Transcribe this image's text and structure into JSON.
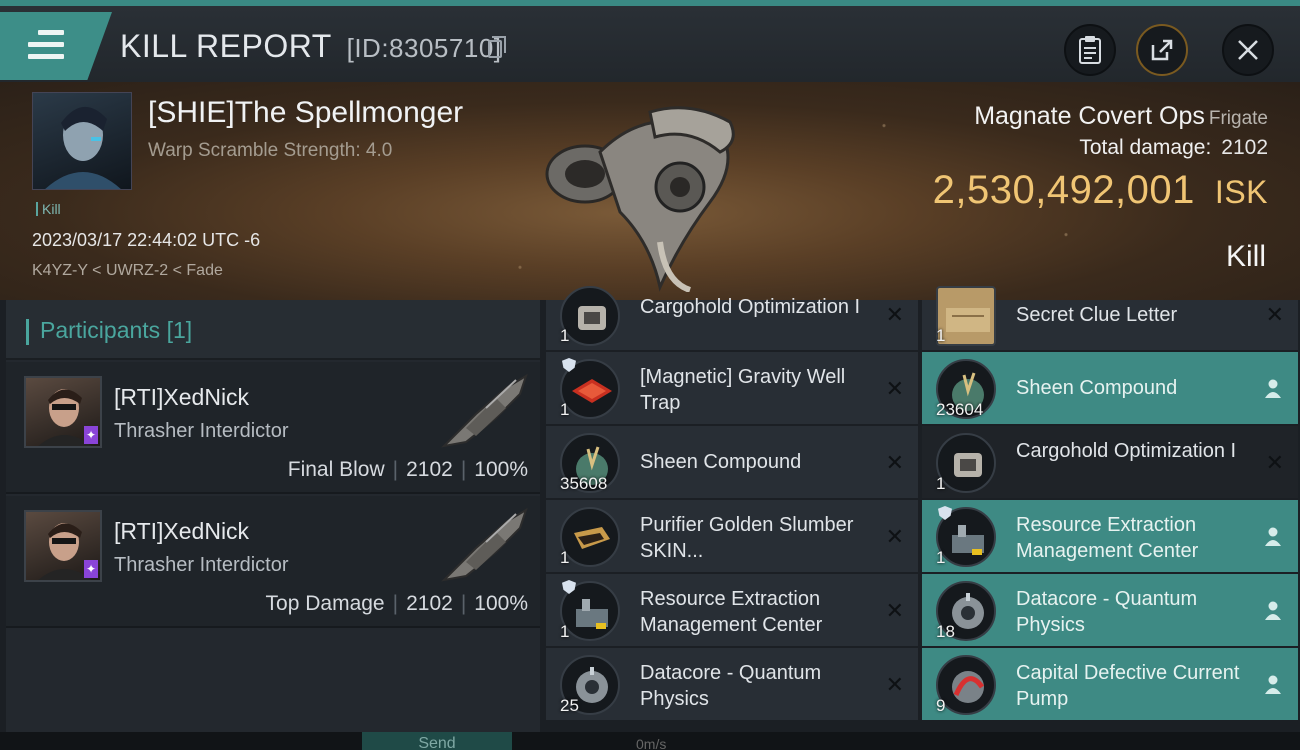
{
  "header": {
    "title": "KILL REPORT",
    "id_text": "[ID:8305710]",
    "icons": [
      "menu-icon",
      "copy-icon",
      "clipboard-icon",
      "share-icon",
      "close-icon"
    ]
  },
  "victim": {
    "name": "[SHIE]The Spellmonger",
    "warp_scramble": "Warp Scramble Strength: 4.0",
    "tag": "Kill",
    "timestamp": "2023/03/17 22:44:02 UTC -6",
    "route": "K4YZ-Y < UWRZ-2 < Fade",
    "ship_name": "Magnate Covert Ops",
    "ship_class": "Frigate",
    "total_damage_label": "Total damage:",
    "total_damage": "2102",
    "isk_value": "2,530,492,001",
    "isk_unit": "ISK",
    "result": "Kill"
  },
  "participants": {
    "label": "Participants",
    "count": "[1]",
    "list": [
      {
        "name": "[RTI]XedNick",
        "ship": "Thrasher Interdictor",
        "role": "Final Blow",
        "damage": "2102",
        "percent": "100%"
      },
      {
        "name": "[RTI]XedNick",
        "ship": "Thrasher Interdictor",
        "role": "Top Damage",
        "damage": "2102",
        "percent": "100%"
      }
    ]
  },
  "items_left": [
    {
      "name": "Cargohold Optimization I",
      "qty": "1",
      "dropped": false
    },
    {
      "name": "[Magnetic] Gravity Well Trap",
      "qty": "1",
      "dropped": false
    },
    {
      "name": "Sheen Compound",
      "qty": "35608",
      "dropped": false
    },
    {
      "name": "Purifier Golden Slumber SKIN...",
      "qty": "1",
      "dropped": false
    },
    {
      "name": "Resource Extraction Management Center",
      "qty": "1",
      "dropped": false
    },
    {
      "name": "Datacore - Quantum Physics",
      "qty": "25",
      "dropped": false
    }
  ],
  "items_right": [
    {
      "name": "Secret Clue Letter",
      "qty": "1",
      "dropped": false
    },
    {
      "name": "Sheen Compound",
      "qty": "23604",
      "dropped": true
    },
    {
      "name": "Cargohold Optimization I",
      "qty": "1",
      "dropped": false
    },
    {
      "name": "Resource Extraction Management Center",
      "qty": "1",
      "dropped": true
    },
    {
      "name": "Datacore - Quantum Physics",
      "qty": "18",
      "dropped": true
    },
    {
      "name": "Capital Defective Current Pump",
      "qty": "9",
      "dropped": true
    }
  ],
  "bottom": {
    "send_label": "Send",
    "speed": "0m/s"
  },
  "colors": {
    "accent": "#3d8e88",
    "isk": "#f0c574",
    "dropped_row": "#3e8a84"
  }
}
